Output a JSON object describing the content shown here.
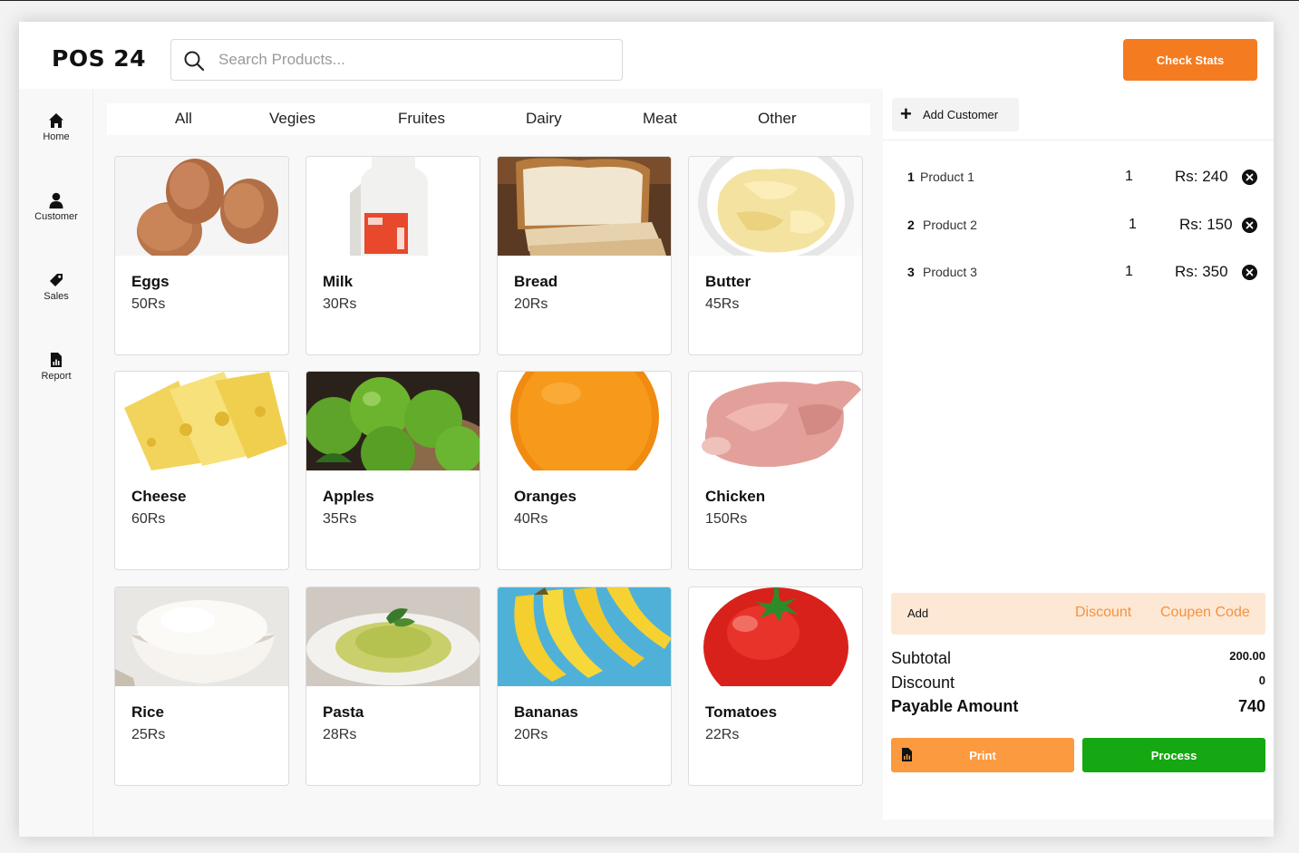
{
  "header": {
    "logo": "POS 24",
    "search_placeholder": "Search Products...",
    "check_stats_label": "Check Stats"
  },
  "sidebar": {
    "items": [
      {
        "label": "Home",
        "icon": "home-icon"
      },
      {
        "label": "Customer",
        "icon": "user-icon"
      },
      {
        "label": "Sales",
        "icon": "tag-icon"
      },
      {
        "label": "Report",
        "icon": "report-icon"
      }
    ]
  },
  "tabs": [
    "All",
    "Vegies",
    "Fruites",
    "Dairy",
    "Meat",
    "Other"
  ],
  "products": [
    {
      "name": "Eggs",
      "price": "50Rs"
    },
    {
      "name": "Milk",
      "price": "30Rs"
    },
    {
      "name": "Bread",
      "price": "20Rs"
    },
    {
      "name": "Butter",
      "price": "45Rs"
    },
    {
      "name": "Cheese",
      "price": "60Rs"
    },
    {
      "name": "Apples",
      "price": "35Rs"
    },
    {
      "name": "Oranges",
      "price": "40Rs"
    },
    {
      "name": "Chicken",
      "price": "150Rs"
    },
    {
      "name": "Rice",
      "price": "25Rs"
    },
    {
      "name": "Pasta",
      "price": "28Rs"
    },
    {
      "name": "Bananas",
      "price": "20Rs"
    },
    {
      "name": "Tomatoes",
      "price": "22Rs"
    }
  ],
  "cart": {
    "add_customer_label": "Add Customer",
    "items": [
      {
        "num": "1",
        "name": "Product 1",
        "qty": "1",
        "amount": "Rs: 240"
      },
      {
        "num": "2",
        "name": "Product 2",
        "qty": "1",
        "amount": "Rs: 150"
      },
      {
        "num": "3",
        "name": "Product 3",
        "qty": "1",
        "amount": "Rs: 350"
      }
    ],
    "add_label": "Add",
    "discount_link": "Discount",
    "coupon_link": "Coupen Code",
    "subtotal_label": "Subtotal",
    "subtotal_value": "200.00",
    "discount_label": "Discount",
    "discount_value": "0",
    "payable_label": "Payable Amount",
    "payable_value": "740",
    "print_label": "Print",
    "process_label": "Process"
  },
  "colors": {
    "accent": "#f47b20",
    "print": "#fb9a3f",
    "process": "#16a812",
    "add_bar": "#fde8d6"
  }
}
